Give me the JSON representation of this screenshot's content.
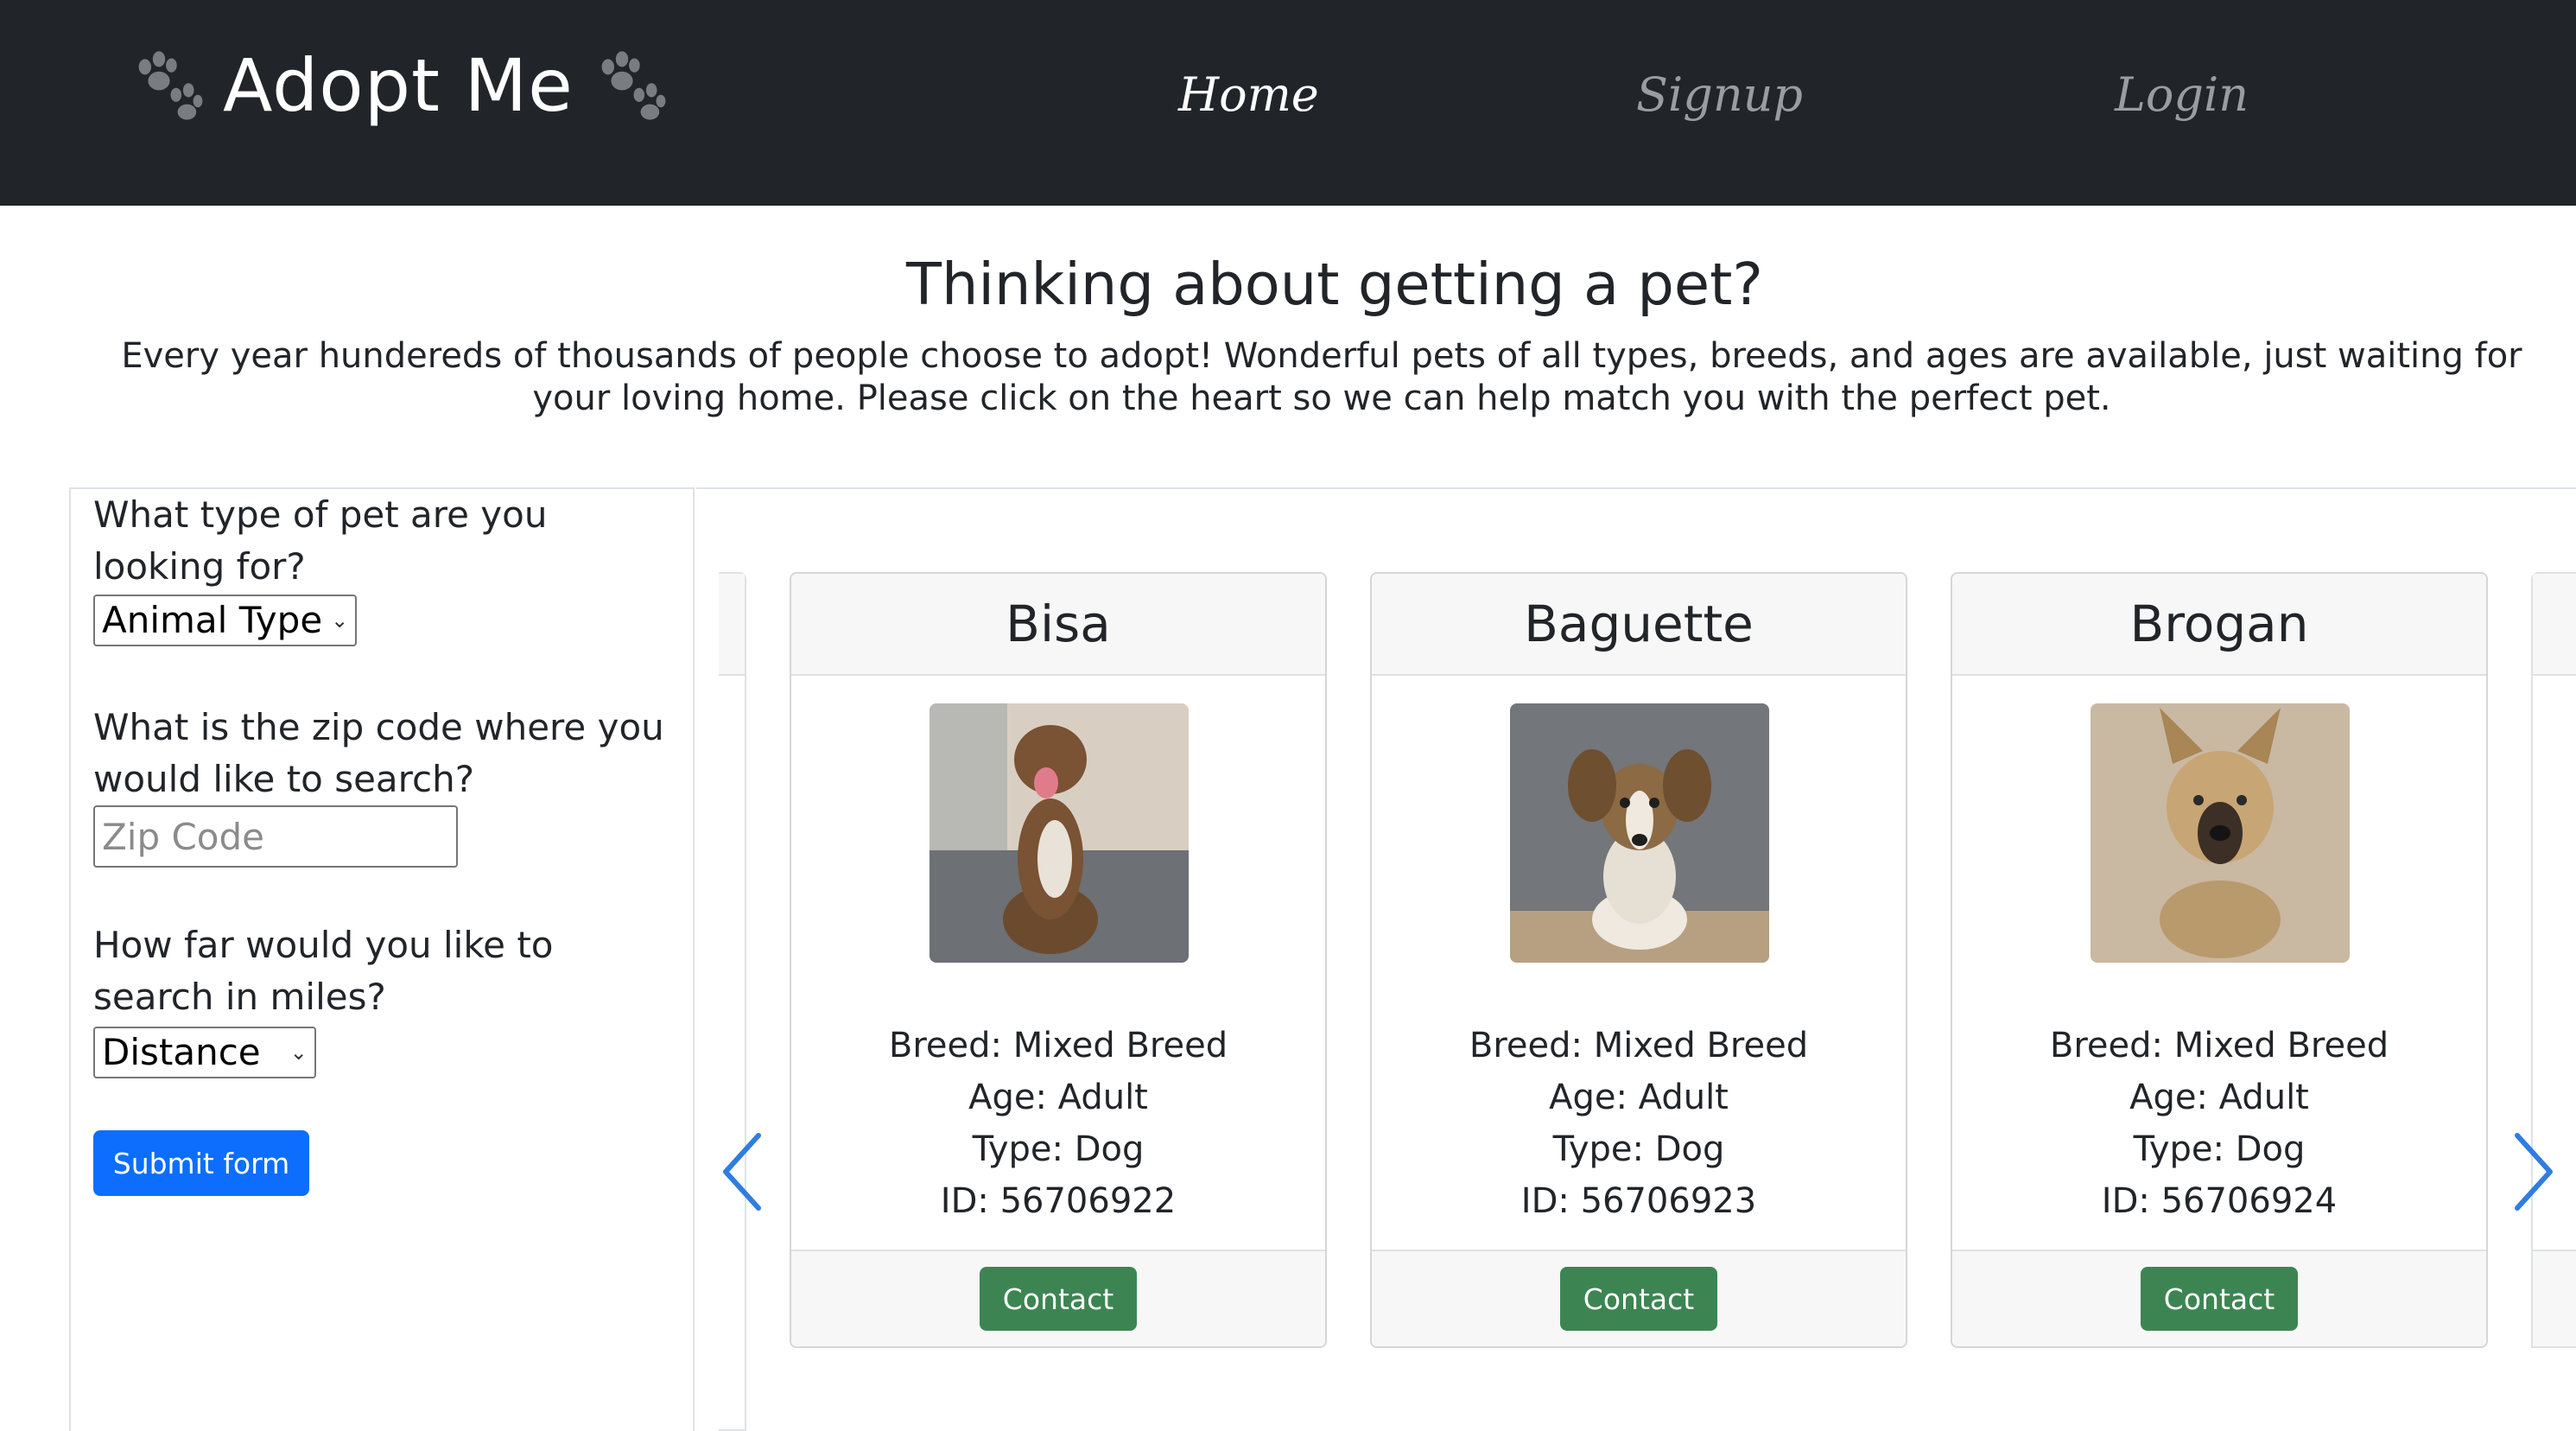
{
  "nav": {
    "brand": "Adopt Me",
    "links": [
      {
        "label": "Home",
        "active": true
      },
      {
        "label": "Signup",
        "active": false
      },
      {
        "label": "Login",
        "active": false
      }
    ]
  },
  "hero": {
    "title": "Thinking about getting a pet?",
    "text": "Every year hundereds of thousands of people choose to adopt! Wonderful pets of all types, breeds, and ages are available, just waiting for your loving home. Please click on the heart so we can help match you with the perfect pet."
  },
  "form": {
    "q_type": "What type of pet are you looking for?",
    "type_select": "Animal Type",
    "q_zip": "What is the zip code where you would like to search?",
    "zip_placeholder": "Zip Code",
    "q_distance": "How far would you like to search in miles?",
    "distance_select": "Distance",
    "submit": "Submit form"
  },
  "pets": [
    {
      "name": "Bisa",
      "breed": "Breed: Mixed Breed",
      "age": "Age: Adult",
      "type": "Type: Dog",
      "id": "ID: 56706922",
      "contact": "Contact"
    },
    {
      "name": "Baguette",
      "breed": "Breed: Mixed Breed",
      "age": "Age: Adult",
      "type": "Type: Dog",
      "id": "ID: 56706923",
      "contact": "Contact"
    },
    {
      "name": "Brogan",
      "breed": "Breed: Mixed Breed",
      "age": "Age: Adult",
      "type": "Type: Dog",
      "id": "ID: 56706924",
      "contact": "Contact"
    }
  ],
  "colors": {
    "navbar": "#212529",
    "primary": "#0d6efd",
    "contact": "#3c8552",
    "arrow": "#2f7de1"
  },
  "icons": {
    "brand_left": "paw-icon",
    "brand_right": "paw-icon",
    "prev": "chevron-left-icon",
    "next": "chevron-right-icon"
  }
}
